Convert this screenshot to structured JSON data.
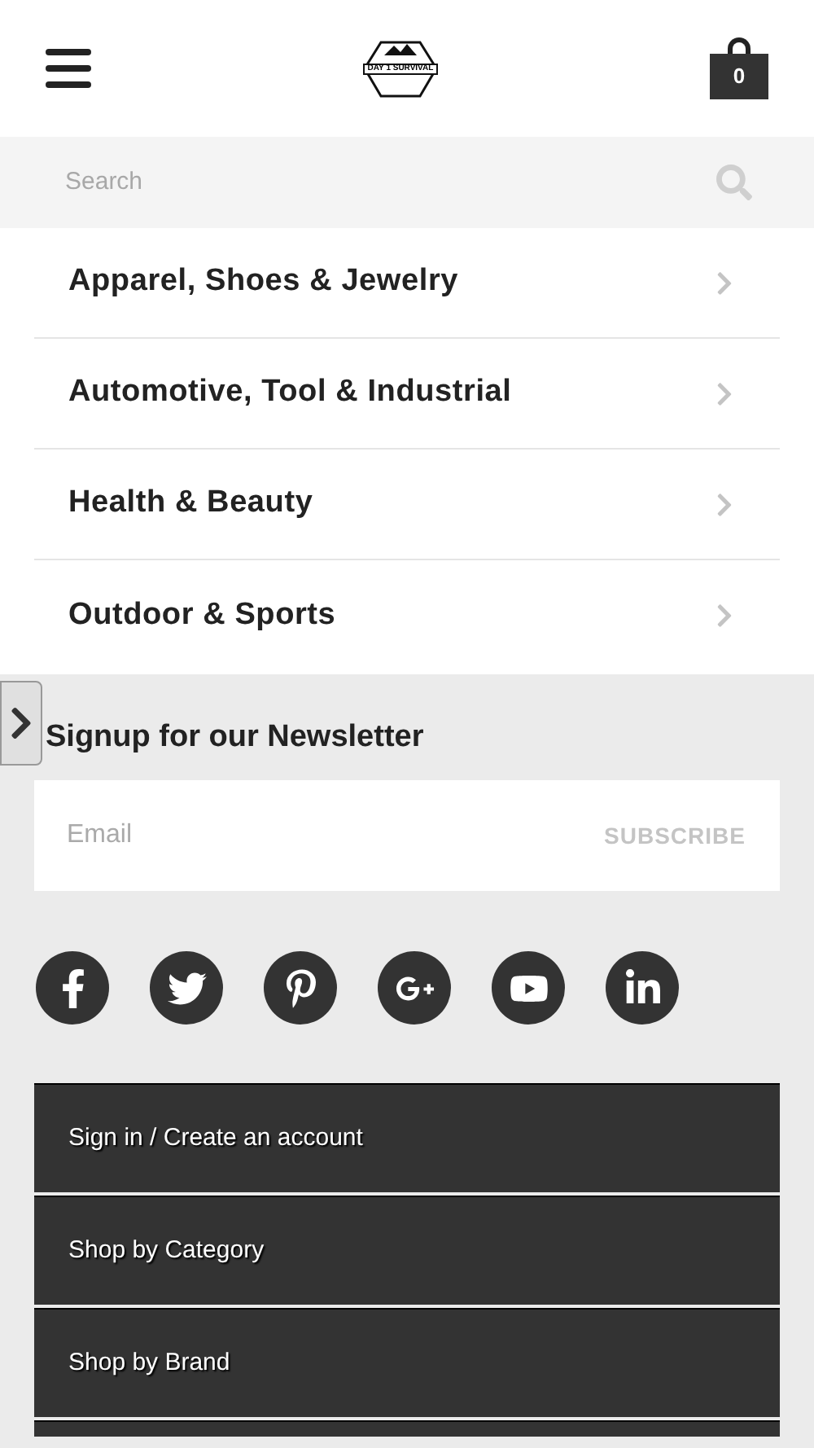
{
  "header": {
    "logo_text": "DAY 1 SURVIVAL",
    "cart_count": "0"
  },
  "search": {
    "placeholder": "Search"
  },
  "categories": [
    {
      "label": "Apparel, Shoes & Jewelry"
    },
    {
      "label": "Automotive, Tool & Industrial"
    },
    {
      "label": "Health & Beauty"
    },
    {
      "label": "Outdoor & Sports"
    }
  ],
  "newsletter": {
    "title": "Signup for our Newsletter",
    "email_placeholder": "Email",
    "subscribe": "SUBSCRIBE"
  },
  "social": [
    {
      "kind": "facebook"
    },
    {
      "kind": "twitter"
    },
    {
      "kind": "pinterest"
    },
    {
      "kind": "googleplus"
    },
    {
      "kind": "youtube"
    },
    {
      "kind": "linkedin"
    }
  ],
  "footer_menu": [
    {
      "label": "Sign in / Create an account"
    },
    {
      "label": "Shop by Category"
    },
    {
      "label": "Shop by Brand"
    }
  ]
}
